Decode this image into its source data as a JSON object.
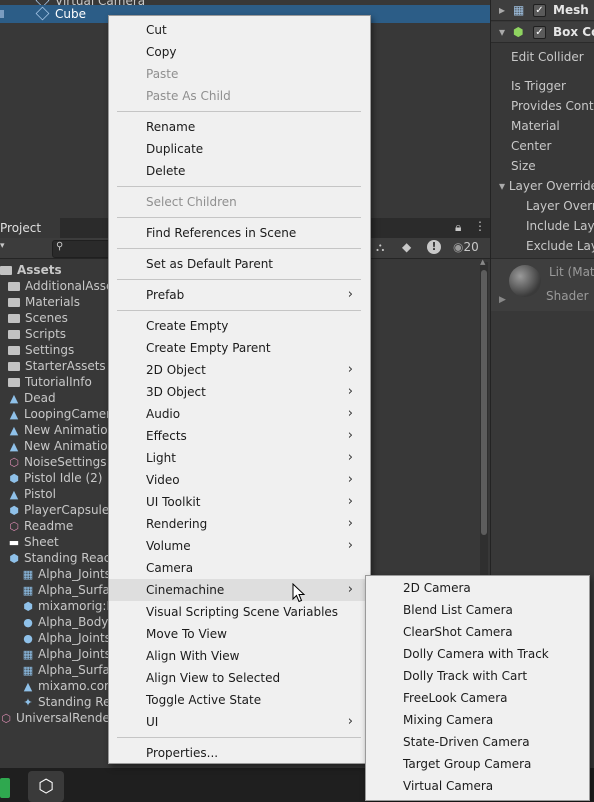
{
  "hierarchy": {
    "rows": [
      "Virtual Camera",
      "Cube"
    ],
    "selected": "Cube"
  },
  "inspector": {
    "components": [
      {
        "name": "Mesh R",
        "checked": true
      },
      {
        "name": "Box Co",
        "checked": true
      }
    ],
    "edit_collider": "Edit Collider",
    "fields": [
      "Is Trigger",
      "Provides Conta",
      "Material",
      "Center",
      "Size"
    ],
    "layer_overrides": "Layer Overrides",
    "layer_sub": [
      "Layer Overri",
      "Include Lay",
      "Exclude Lay"
    ],
    "material_name": "Lit (Mat",
    "shader_label": "Shader"
  },
  "project": {
    "tab_label": "Project",
    "count_badge": "20",
    "tree": [
      {
        "label": "Assets",
        "type": "folder",
        "indent": 0
      },
      {
        "label": "AdditionalAsse",
        "type": "folder",
        "indent": 1
      },
      {
        "label": "Materials",
        "type": "folder",
        "indent": 1
      },
      {
        "label": "Scenes",
        "type": "folder",
        "indent": 1
      },
      {
        "label": "Scripts",
        "type": "folder",
        "indent": 1
      },
      {
        "label": "Settings",
        "type": "folder",
        "indent": 1
      },
      {
        "label": "StarterAssets",
        "type": "folder",
        "indent": 1
      },
      {
        "label": "TutorialInfo",
        "type": "folder",
        "indent": 1
      },
      {
        "label": "Dead",
        "type": "anim",
        "indent": 1
      },
      {
        "label": "LoopingCamera",
        "type": "anim",
        "indent": 1
      },
      {
        "label": "New Animation",
        "type": "anim",
        "indent": 1
      },
      {
        "label": "New Animation",
        "type": "anim",
        "indent": 1
      },
      {
        "label": "NoiseSettings",
        "type": "asset",
        "indent": 1
      },
      {
        "label": "Pistol Idle (2)",
        "type": "prefab",
        "indent": 1
      },
      {
        "label": "Pistol",
        "type": "anim",
        "indent": 1
      },
      {
        "label": "PlayerCapsule",
        "type": "prefab",
        "indent": 1
      },
      {
        "label": "Readme",
        "type": "asset",
        "indent": 1
      },
      {
        "label": "Sheet",
        "type": "line",
        "indent": 1
      },
      {
        "label": "Standing React",
        "type": "prefab",
        "indent": 1
      },
      {
        "label": "Alpha_Joints",
        "type": "mesh",
        "indent": 2
      },
      {
        "label": "Alpha_Surfac",
        "type": "mesh",
        "indent": 2
      },
      {
        "label": "mixamorig:Hi",
        "type": "prefab",
        "indent": 2
      },
      {
        "label": "Alpha_Body_",
        "type": "mat",
        "indent": 2
      },
      {
        "label": "Alpha_Joints",
        "type": "mat",
        "indent": 2
      },
      {
        "label": "Alpha_Joints",
        "type": "grid",
        "indent": 2
      },
      {
        "label": "Alpha_Surfac",
        "type": "grid",
        "indent": 2
      },
      {
        "label": "mixamo.com",
        "type": "anim",
        "indent": 2
      },
      {
        "label": "Standing Rea",
        "type": "avatar",
        "indent": 2
      },
      {
        "label": "UniversalRende",
        "type": "asset",
        "indent": 0
      }
    ]
  },
  "context_menu": {
    "items": [
      {
        "label": "Cut",
        "enabled": true
      },
      {
        "label": "Copy",
        "enabled": true
      },
      {
        "label": "Paste",
        "enabled": false
      },
      {
        "label": "Paste As Child",
        "enabled": false
      },
      {
        "sep": true
      },
      {
        "label": "Rename",
        "enabled": true
      },
      {
        "label": "Duplicate",
        "enabled": true
      },
      {
        "label": "Delete",
        "enabled": true
      },
      {
        "sep": true
      },
      {
        "label": "Select Children",
        "enabled": false
      },
      {
        "sep": true
      },
      {
        "label": "Find References in Scene",
        "enabled": true
      },
      {
        "sep": true
      },
      {
        "label": "Set as Default Parent",
        "enabled": true
      },
      {
        "sep": true
      },
      {
        "label": "Prefab",
        "enabled": true,
        "submenu": true
      },
      {
        "sep": true
      },
      {
        "label": "Create Empty",
        "enabled": true
      },
      {
        "label": "Create Empty Parent",
        "enabled": true
      },
      {
        "label": "2D Object",
        "enabled": true,
        "submenu": true
      },
      {
        "label": "3D Object",
        "enabled": true,
        "submenu": true
      },
      {
        "label": "Audio",
        "enabled": true,
        "submenu": true
      },
      {
        "label": "Effects",
        "enabled": true,
        "submenu": true
      },
      {
        "label": "Light",
        "enabled": true,
        "submenu": true
      },
      {
        "label": "Video",
        "enabled": true,
        "submenu": true
      },
      {
        "label": "UI Toolkit",
        "enabled": true,
        "submenu": true
      },
      {
        "label": "Rendering",
        "enabled": true,
        "submenu": true
      },
      {
        "label": "Volume",
        "enabled": true,
        "submenu": true
      },
      {
        "label": "Camera",
        "enabled": true
      },
      {
        "label": "Cinemachine",
        "enabled": true,
        "submenu": true,
        "highlighted": true
      },
      {
        "label": "Visual Scripting Scene Variables",
        "enabled": true
      },
      {
        "label": "Move To View",
        "enabled": true
      },
      {
        "label": "Align With View",
        "enabled": true
      },
      {
        "label": "Align View to Selected",
        "enabled": true
      },
      {
        "label": "Toggle Active State",
        "enabled": true
      },
      {
        "label": "UI",
        "enabled": true,
        "submenu": true
      },
      {
        "sep": true
      },
      {
        "label": "Properties...",
        "enabled": true
      }
    ]
  },
  "cinemachine_submenu": {
    "items": [
      "2D Camera",
      "Blend List Camera",
      "ClearShot Camera",
      "Dolly Camera with Track",
      "Dolly Track with Cart",
      "FreeLook Camera",
      "Mixing Camera",
      "State-Driven Camera",
      "Target Group Camera",
      "Virtual Camera"
    ]
  },
  "colors": {
    "selection": "#2c5d87",
    "menu_bg": "#f0f0f0",
    "menu_highlight": "#dedede",
    "panel_bg": "#383838"
  }
}
